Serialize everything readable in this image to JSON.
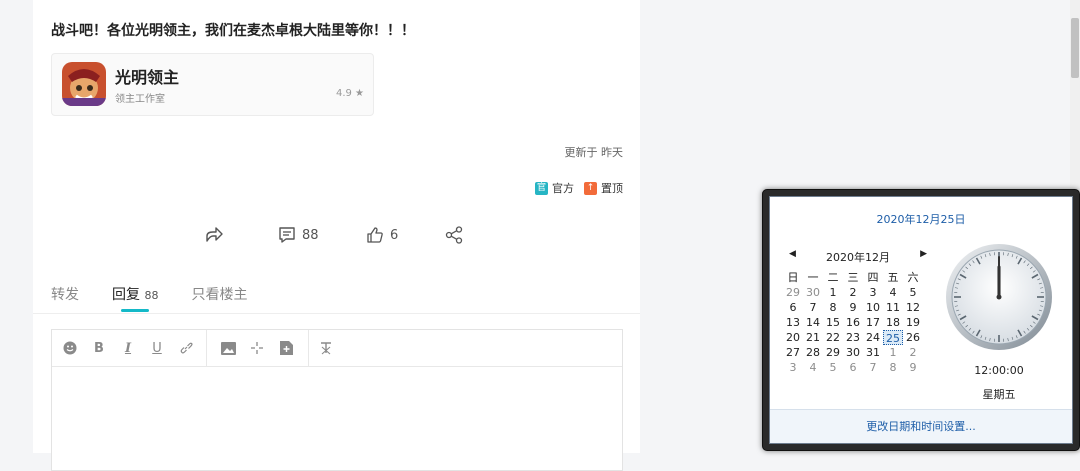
{
  "post": {
    "title": "战斗吧！各位光明领主，我们在麦杰卓根大陆里等你！！！",
    "app": {
      "name": "光明领主",
      "developer": "领主工作室",
      "rating": "4.9 ★"
    },
    "updated": "更新于 昨天",
    "badges": {
      "official_icon": "官",
      "official_label": "官方",
      "official_color": "#26b5c4",
      "pinned_icon": "↑",
      "pinned_label": "置顶",
      "pinned_color": "#f26b3a"
    },
    "actions": {
      "comments": "88",
      "likes": "6"
    },
    "tabs": [
      {
        "label": "转发"
      },
      {
        "label": "回复",
        "count": "88"
      },
      {
        "label": "只看楼主"
      }
    ],
    "editor": {
      "tools": [
        "emoji-icon",
        "bold-icon",
        "italic-icon",
        "underline-icon",
        "link-icon",
        "image-icon",
        "move-icon",
        "attachment-icon",
        "clear-format-icon"
      ]
    }
  },
  "calendar": {
    "header_date": "2020年12月25日",
    "month_label": "2020年12月",
    "weekdays": [
      "日",
      "一",
      "二",
      "三",
      "四",
      "五",
      "六"
    ],
    "weeks": [
      [
        "29",
        "30",
        "1",
        "2",
        "3",
        "4",
        "5"
      ],
      [
        "6",
        "7",
        "8",
        "9",
        "10",
        "11",
        "12"
      ],
      [
        "13",
        "14",
        "15",
        "16",
        "17",
        "18",
        "19"
      ],
      [
        "20",
        "21",
        "22",
        "23",
        "24",
        "25",
        "26"
      ],
      [
        "27",
        "28",
        "29",
        "30",
        "31",
        "1",
        "2"
      ],
      [
        "3",
        "4",
        "5",
        "6",
        "7",
        "8",
        "9"
      ]
    ],
    "today": "25",
    "time": "12:00:00",
    "weekday": "星期五",
    "footer_link": "更改日期和时间设置..."
  }
}
